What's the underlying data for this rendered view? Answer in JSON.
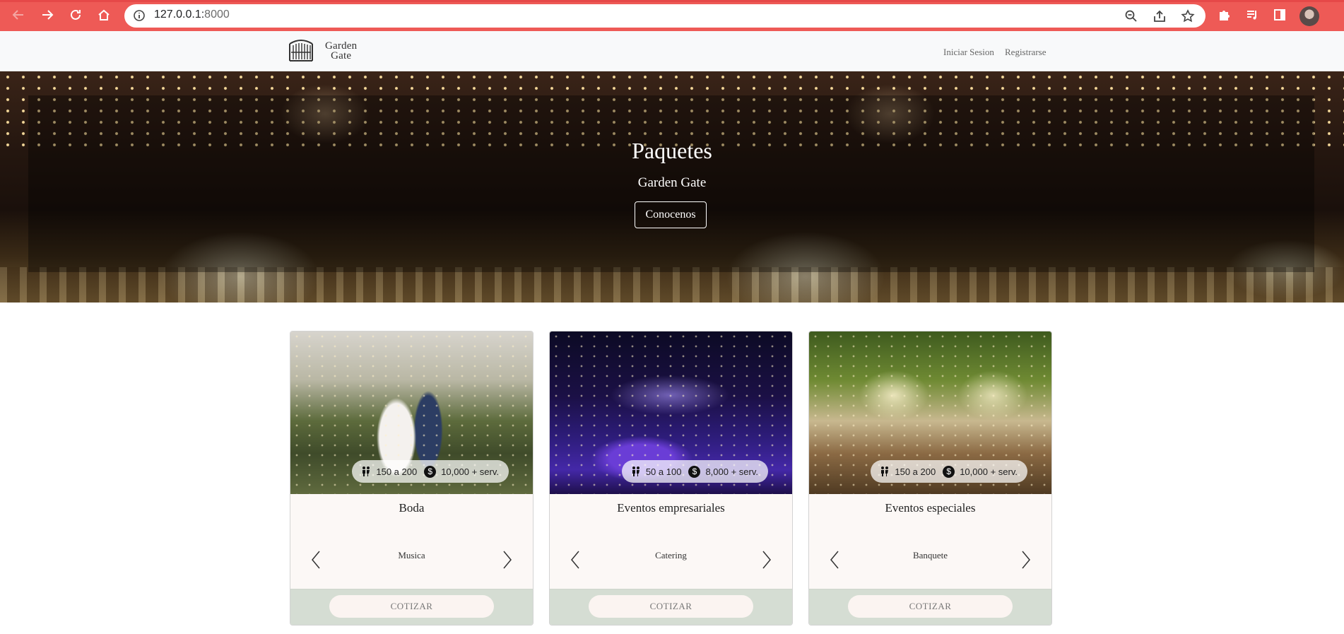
{
  "browser": {
    "url_host": "127.0.0.1:",
    "url_port": "8000",
    "accent": "#ee5a56"
  },
  "site": {
    "logo_line1": "Garden",
    "logo_line2": "Gate",
    "nav": [
      "Iniciar Sesion",
      "Registrarse"
    ]
  },
  "hero": {
    "title": "Paquetes",
    "subtitle": "Garden Gate",
    "button": "Conocenos"
  },
  "cards": [
    {
      "title": "Boda",
      "guests": "150 a 200",
      "price": "10,000 + serv.",
      "feature": "Musica",
      "button": "COTIZAR"
    },
    {
      "title": "Eventos empresariales",
      "guests": "50 a 100",
      "price": "8,000 + serv.",
      "feature": "Catering",
      "button": "COTIZAR"
    },
    {
      "title": "Eventos especiales",
      "guests": "150 a 200",
      "price": "10,000 + serv.",
      "feature": "Banquete",
      "button": "COTIZAR"
    }
  ],
  "icons": {
    "dollar_symbol": "$"
  }
}
